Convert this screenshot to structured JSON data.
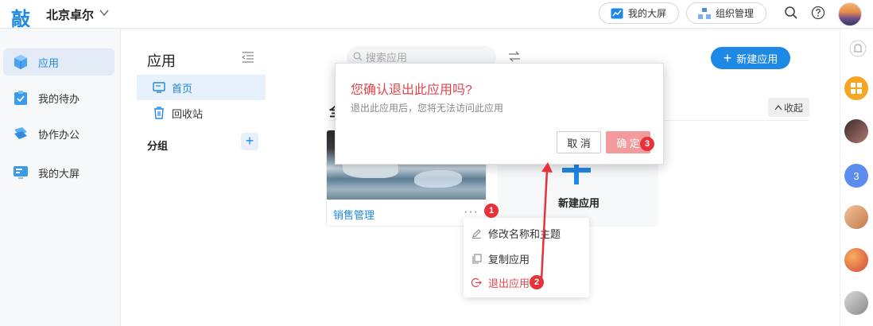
{
  "topbar": {
    "logo": "敲",
    "org_name": "北京卓尔",
    "bigscreen_label": "我的大屏",
    "org_manage_label": "组织管理"
  },
  "leftnav": {
    "items": [
      {
        "label": "应用",
        "active": true,
        "icon": "cube-icon"
      },
      {
        "label": "我的待办",
        "active": false,
        "icon": "todo-check-icon"
      },
      {
        "label": "协作办公",
        "active": false,
        "icon": "collaboration-icon"
      },
      {
        "label": "我的大屏",
        "active": false,
        "icon": "monitor-icon"
      }
    ]
  },
  "apppanel": {
    "title": "应用",
    "items": [
      {
        "label": "首页",
        "active": true
      },
      {
        "label": "回收站",
        "active": false
      }
    ],
    "group_label": "分组",
    "group_add": "+"
  },
  "main": {
    "search_placeholder": "搜索应用",
    "new_app_label": "新建应用",
    "section_title": "全",
    "collapse_label": "收起",
    "app_card_name": "销售管理",
    "more_dots": "···",
    "new_card_label": "新建应用"
  },
  "context_menu": {
    "items": [
      {
        "label": "修改名称和主题",
        "icon": "edit-icon"
      },
      {
        "label": "复制应用",
        "icon": "copy-icon"
      },
      {
        "label": "退出应用",
        "icon": "exit-icon",
        "danger": true
      }
    ]
  },
  "dialog": {
    "title": "您确认退出此应用吗?",
    "message": "退出此应用后，您将无法访问此应用",
    "cancel_label": "取 消",
    "confirm_label": "确 定"
  },
  "badges": [
    "1",
    "2",
    "3"
  ],
  "rightrail": {
    "number_badge": "3"
  },
  "colors": {
    "accent": "#1e88e5",
    "danger": "#e0454b",
    "confirm_disabled": "#f39a9c",
    "badge": "#e6333a"
  }
}
